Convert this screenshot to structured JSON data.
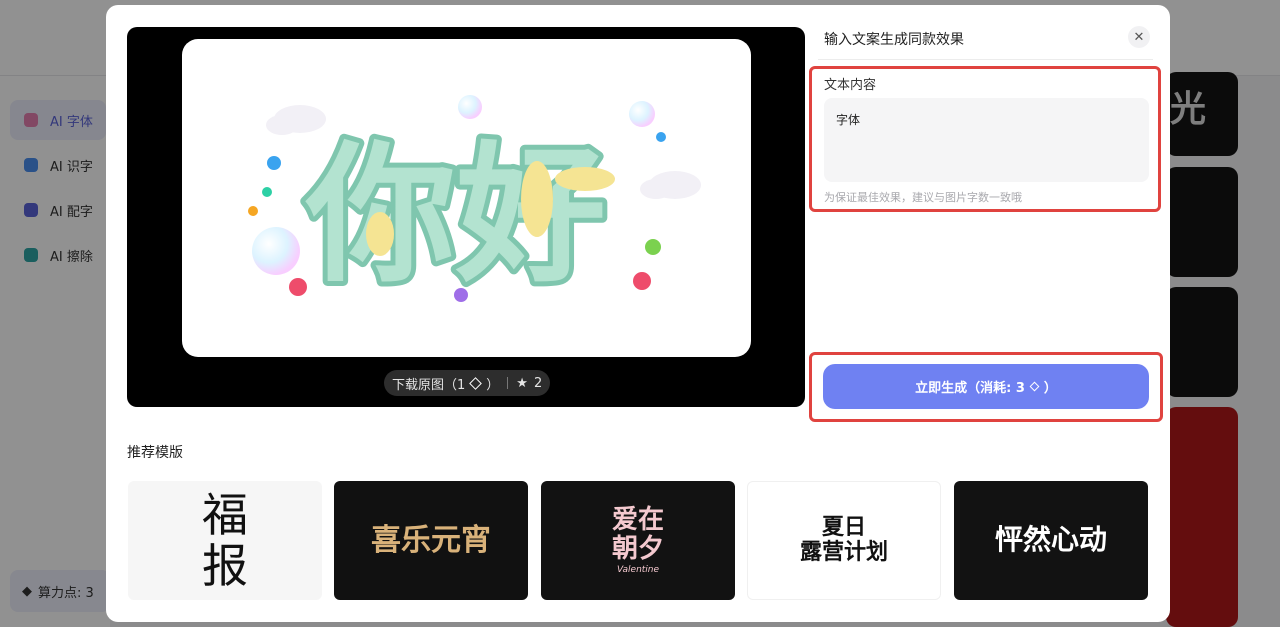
{
  "sidebar": {
    "items": [
      {
        "label": "AI 字体",
        "active": true,
        "icon": "gem-icon"
      },
      {
        "label": "AI 识字",
        "active": false,
        "icon": "wave-icon"
      },
      {
        "label": "AI 配字",
        "active": false,
        "icon": "image-icon"
      },
      {
        "label": "AI 擦除",
        "active": false,
        "icon": "eraser-icon"
      }
    ],
    "points_label": "算力点: 3"
  },
  "background_cards": {
    "card_1_text": "光"
  },
  "modal": {
    "title": "输入文案生成同款效果",
    "close_icon": "close-icon",
    "preview": {
      "headline": "你好",
      "download_label": "下载原图（1",
      "download_suffix": "）",
      "star_count": "2"
    },
    "text_section": {
      "label": "文本内容",
      "value": "字体",
      "hint": "为保证最佳效果，建议与图片字数一致哦"
    },
    "generate": {
      "label": "立即生成（消耗: 3",
      "suffix": "）"
    },
    "recommend": {
      "title": "推荐模版",
      "templates": [
        {
          "text": "福\n报"
        },
        {
          "text": "喜乐元宵"
        },
        {
          "text": "爱在\n朝夕",
          "sub": "Valentine"
        },
        {
          "text": "夏日\n露营计划"
        },
        {
          "text": "怦然心动"
        }
      ]
    }
  },
  "colors": {
    "accent": "#6f81f2",
    "highlight": "#e0433f"
  }
}
